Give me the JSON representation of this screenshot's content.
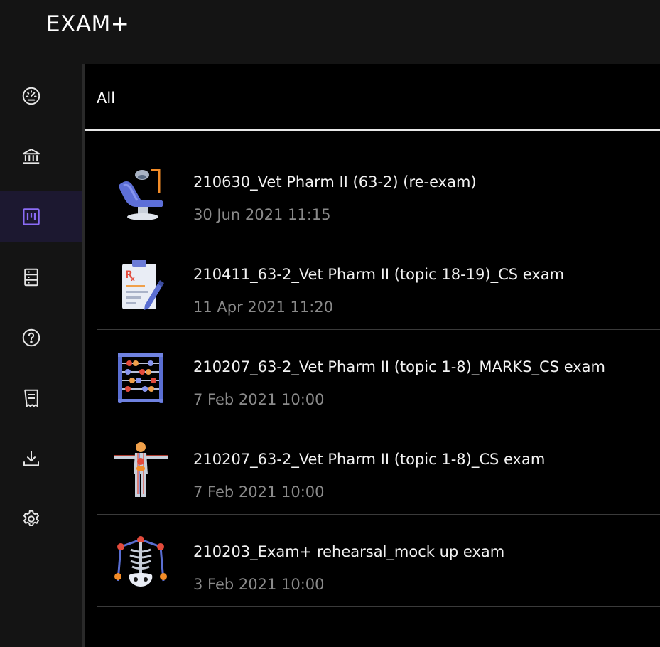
{
  "app": {
    "title": "EXAM+"
  },
  "sidebar": {
    "items": [
      {
        "icon": "dashboard-gauge-icon",
        "active": false
      },
      {
        "icon": "bank-icon",
        "active": false
      },
      {
        "icon": "board-icon",
        "active": true
      },
      {
        "icon": "list-server-icon",
        "active": false
      },
      {
        "icon": "help-circle-icon",
        "active": false
      },
      {
        "icon": "document-icon",
        "active": false
      },
      {
        "icon": "download-icon",
        "active": false
      },
      {
        "icon": "settings-gear-icon",
        "active": false
      }
    ],
    "accent_color": "#8b6cf6"
  },
  "filter": {
    "label": "All"
  },
  "exams": [
    {
      "title": "210630_Vet Pharm II (63-2) (re-exam)",
      "date": "30 Jun 2021 11:15",
      "icon": "dental-chair-icon"
    },
    {
      "title": "210411_63-2_Vet Pharm II (topic 18-19)_CS exam",
      "date": "11 Apr 2021 11:20",
      "icon": "prescription-clipboard-icon"
    },
    {
      "title": "210207_63-2_Vet Pharm II (topic 1-8)_MARKS_CS exam",
      "date": "7 Feb 2021 10:00",
      "icon": "abacus-icon"
    },
    {
      "title": "210207_63-2_Vet Pharm II (topic 1-8)_CS exam",
      "date": "7 Feb 2021 10:00",
      "icon": "human-anatomy-icon"
    },
    {
      "title": "210203_Exam+ rehearsal_mock up exam",
      "date": "3 Feb 2021 10:00",
      "icon": "skeleton-icon"
    }
  ]
}
